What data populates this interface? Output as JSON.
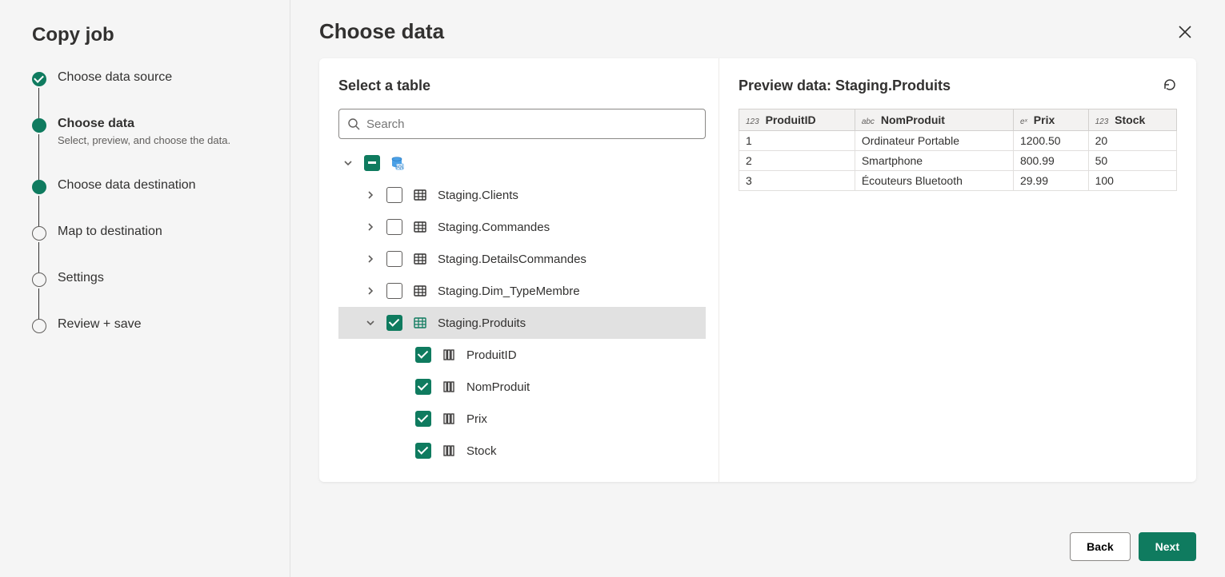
{
  "sidebar": {
    "title": "Copy job",
    "steps": [
      {
        "label": "Choose data source",
        "state": "done"
      },
      {
        "label": "Choose data",
        "sub": "Select, preview, and choose the data.",
        "state": "active"
      },
      {
        "label": "Choose data destination",
        "state": "filled"
      },
      {
        "label": "Map to destination",
        "state": "pending"
      },
      {
        "label": "Settings",
        "state": "pending"
      },
      {
        "label": "Review + save",
        "state": "pending"
      }
    ]
  },
  "header": {
    "title": "Choose data"
  },
  "leftPane": {
    "title": "Select a table",
    "searchPlaceholder": "Search",
    "tables": [
      {
        "name": "Staging.Clients",
        "checked": false,
        "expanded": false
      },
      {
        "name": "Staging.Commandes",
        "checked": false,
        "expanded": false
      },
      {
        "name": "Staging.DetailsCommandes",
        "checked": false,
        "expanded": false
      },
      {
        "name": "Staging.Dim_TypeMembre",
        "checked": false,
        "expanded": false
      },
      {
        "name": "Staging.Produits",
        "checked": true,
        "expanded": true,
        "selected": true
      }
    ],
    "columns": [
      {
        "name": "ProduitID",
        "checked": true
      },
      {
        "name": "NomProduit",
        "checked": true
      },
      {
        "name": "Prix",
        "checked": true
      },
      {
        "name": "Stock",
        "checked": true
      }
    ]
  },
  "preview": {
    "title": "Preview data: Staging.Produits",
    "headers": [
      {
        "type": "123",
        "name": "ProduitID"
      },
      {
        "type": "abc",
        "name": "NomProduit"
      },
      {
        "type": "eˣ",
        "name": "Prix"
      },
      {
        "type": "123",
        "name": "Stock"
      }
    ],
    "rows": [
      [
        "1",
        "Ordinateur Portable",
        "1200.50",
        "20"
      ],
      [
        "2",
        "Smartphone",
        "800.99",
        "50"
      ],
      [
        "3",
        "Écouteurs Bluetooth",
        "29.99",
        "100"
      ]
    ]
  },
  "footer": {
    "back": "Back",
    "next": "Next"
  }
}
